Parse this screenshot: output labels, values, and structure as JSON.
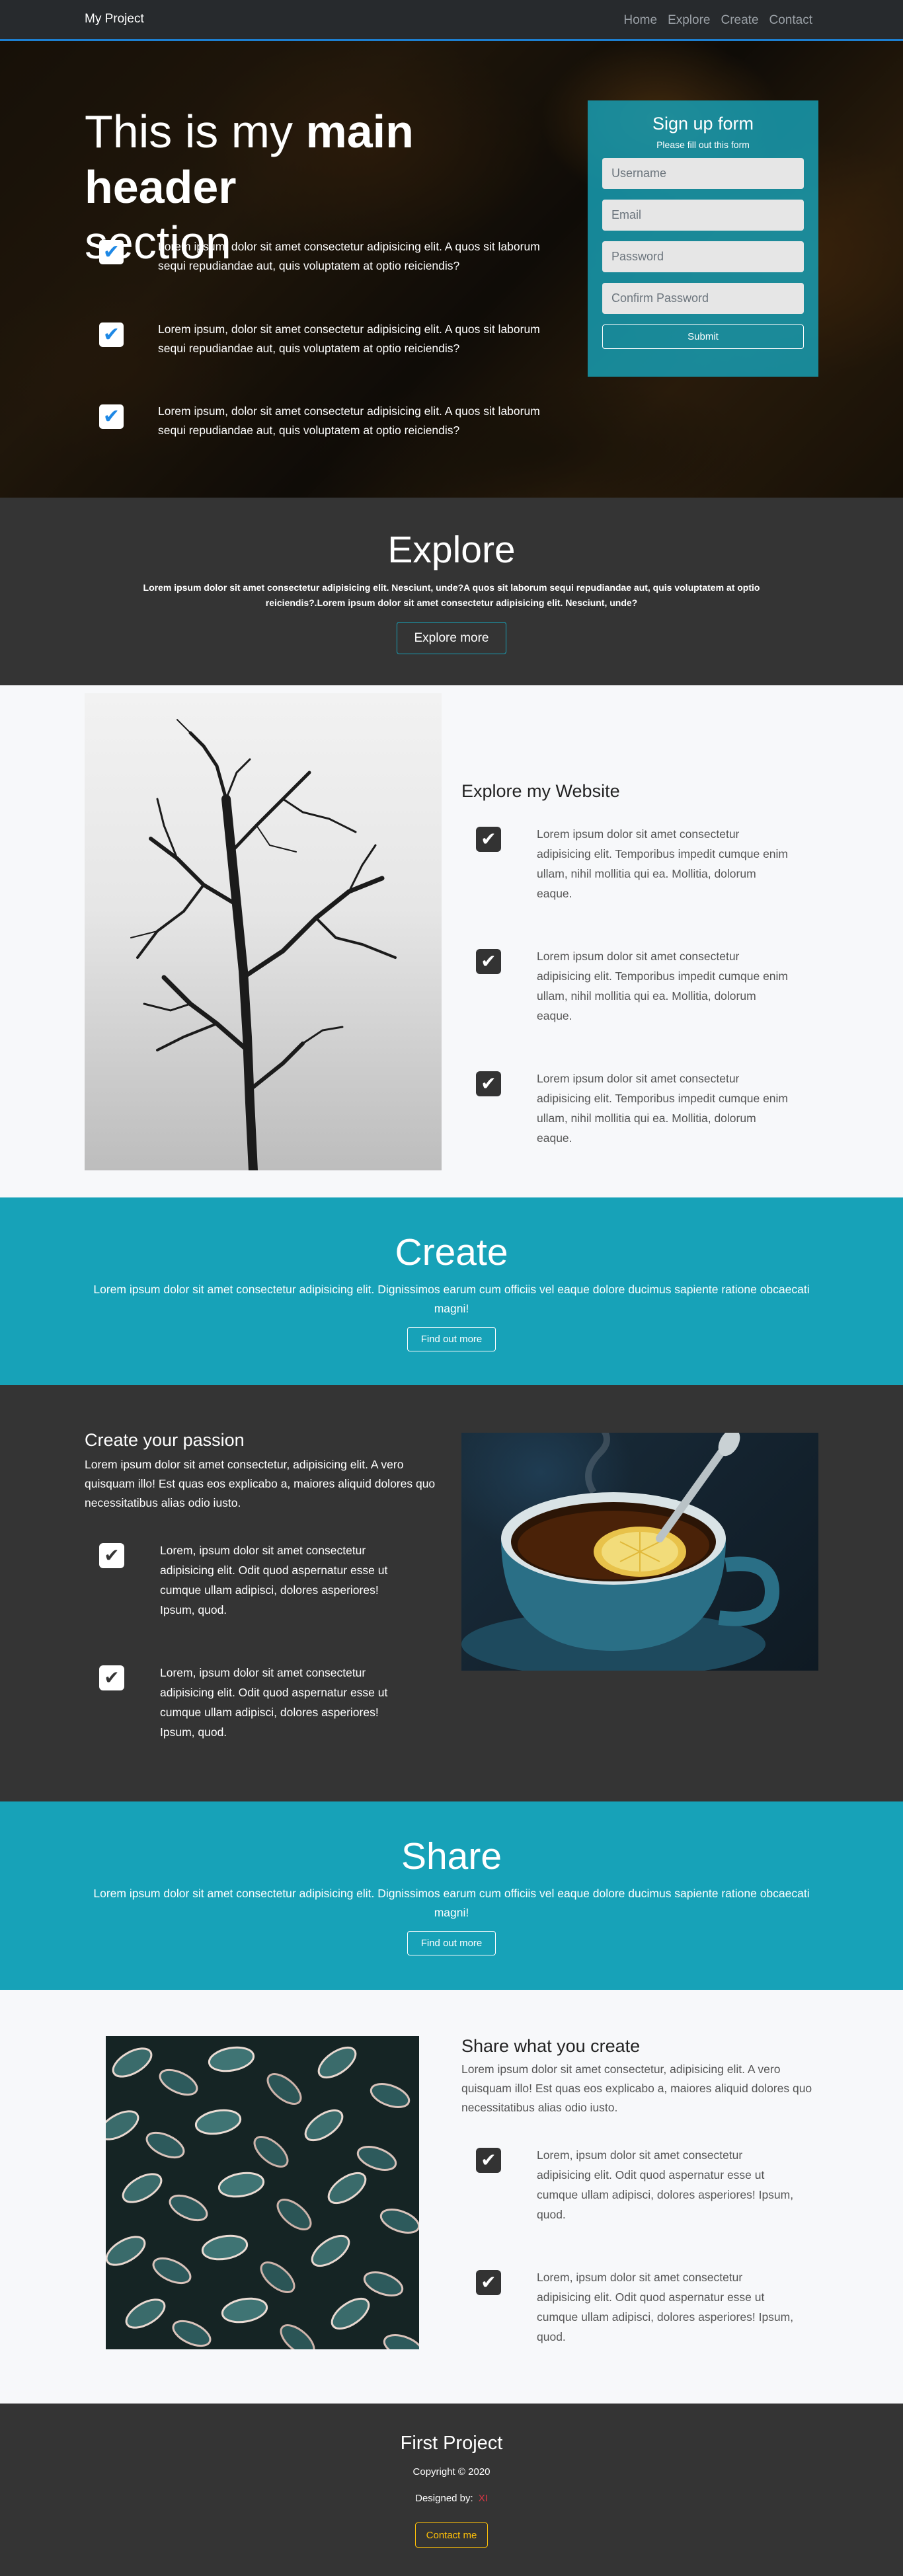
{
  "navbar": {
    "brand": "My Project",
    "links": [
      "Home",
      "Explore",
      "Create",
      "Contact"
    ]
  },
  "hero": {
    "title_light1": "This is my ",
    "title_bold": "main header",
    "title_light2": "section",
    "features": [
      "Lorem ipsum, dolor sit amet consectetur adipisicing elit. A quos sit laborum sequi repudiandae aut, quis voluptatem at optio reiciendis?",
      "Lorem ipsum, dolor sit amet consectetur adipisicing elit. A quos sit laborum sequi repudiandae aut, quis voluptatem at optio reiciendis?",
      "Lorem ipsum, dolor sit amet consectetur adipisicing elit. A quos sit laborum sequi repudiandae aut, quis voluptatem at optio reiciendis?"
    ],
    "check_icon": "check-icon"
  },
  "signup": {
    "title": "Sign up form",
    "subtitle": "Please fill out this form",
    "username_placeholder": "Username",
    "email_placeholder": "Email",
    "password_placeholder": "Password",
    "confirm_placeholder": "Confirm Password",
    "submit_label": "Submit"
  },
  "explore": {
    "title": "Explore",
    "text": "Lorem ipsum dolor sit amet consectetur adipisicing elit. Nesciunt, unde?A quos sit laborum sequi repudiandae aut, quis voluptatem at optio reiciendis?.Lorem ipsum dolor sit amet consectetur adipisicing elit. Nesciunt, unde?",
    "button_label": "Explore more"
  },
  "explore_website": {
    "title": "Explore my Website",
    "features": [
      "Lorem ipsum dolor sit amet consectetur adipisicing elit. Temporibus impedit cumque enim ullam, nihil mollitia qui ea. Mollitia, dolorum eaque.",
      "Lorem ipsum dolor sit amet consectetur adipisicing elit. Temporibus impedit cumque enim ullam, nihil mollitia qui ea. Mollitia, dolorum eaque.",
      "Lorem ipsum dolor sit amet consectetur adipisicing elit. Temporibus impedit cumque enim ullam, nihil mollitia qui ea. Mollitia, dolorum eaque."
    ]
  },
  "create": {
    "title": "Create",
    "text": "Lorem ipsum dolor sit amet consectetur adipisicing elit. Dignissimos earum cum officiis vel eaque dolore ducimus sapiente ratione obcaecati magni!",
    "button_label": "Find out more"
  },
  "passion": {
    "title": "Create your passion",
    "intro": "Lorem ipsum dolor sit amet consectetur, adipisicing elit. A vero quisquam illo! Est quas eos explicabo a, maiores aliquid dolores quo necessitatibus alias odio iusto.",
    "features": [
      "Lorem, ipsum dolor sit amet consectetur adipisicing elit. Odit quod aspernatur esse ut cumque ullam adipisci, dolores asperiores! Ipsum, quod.",
      "Lorem, ipsum dolor sit amet consectetur adipisicing elit. Odit quod aspernatur esse ut cumque ullam adipisci, dolores asperiores! Ipsum, quod."
    ]
  },
  "share": {
    "title": "Share",
    "text": "Lorem ipsum dolor sit amet consectetur adipisicing elit. Dignissimos earum cum officiis vel eaque dolore ducimus sapiente ratione obcaecati magni!",
    "button_label": "Find out more"
  },
  "share_create": {
    "title": "Share what you create",
    "intro": "Lorem ipsum dolor sit amet consectetur, adipisicing elit. A vero quisquam illo! Est quas eos explicabo a, maiores aliquid dolores quo necessitatibus alias odio iusto.",
    "features": [
      "Lorem, ipsum dolor sit amet consectetur adipisicing elit. Odit quod aspernatur esse ut cumque ullam adipisci, dolores asperiores! Ipsum, quod.",
      "Lorem, ipsum dolor sit amet consectetur adipisicing elit. Odit quod aspernatur esse ut cumque ullam adipisci, dolores asperiores! Ipsum, quod."
    ]
  },
  "footer": {
    "title": "First Project",
    "copyright": "Copyright © 2020",
    "designed_label": "Designed by:",
    "designer": "XI",
    "contact_label": "Contact me"
  },
  "colors": {
    "teal": "#17a2b8",
    "dark": "#343434",
    "nav_accent": "#1d7fd0",
    "footer_button": "#ffc107",
    "designer_name": "#dc3545"
  }
}
